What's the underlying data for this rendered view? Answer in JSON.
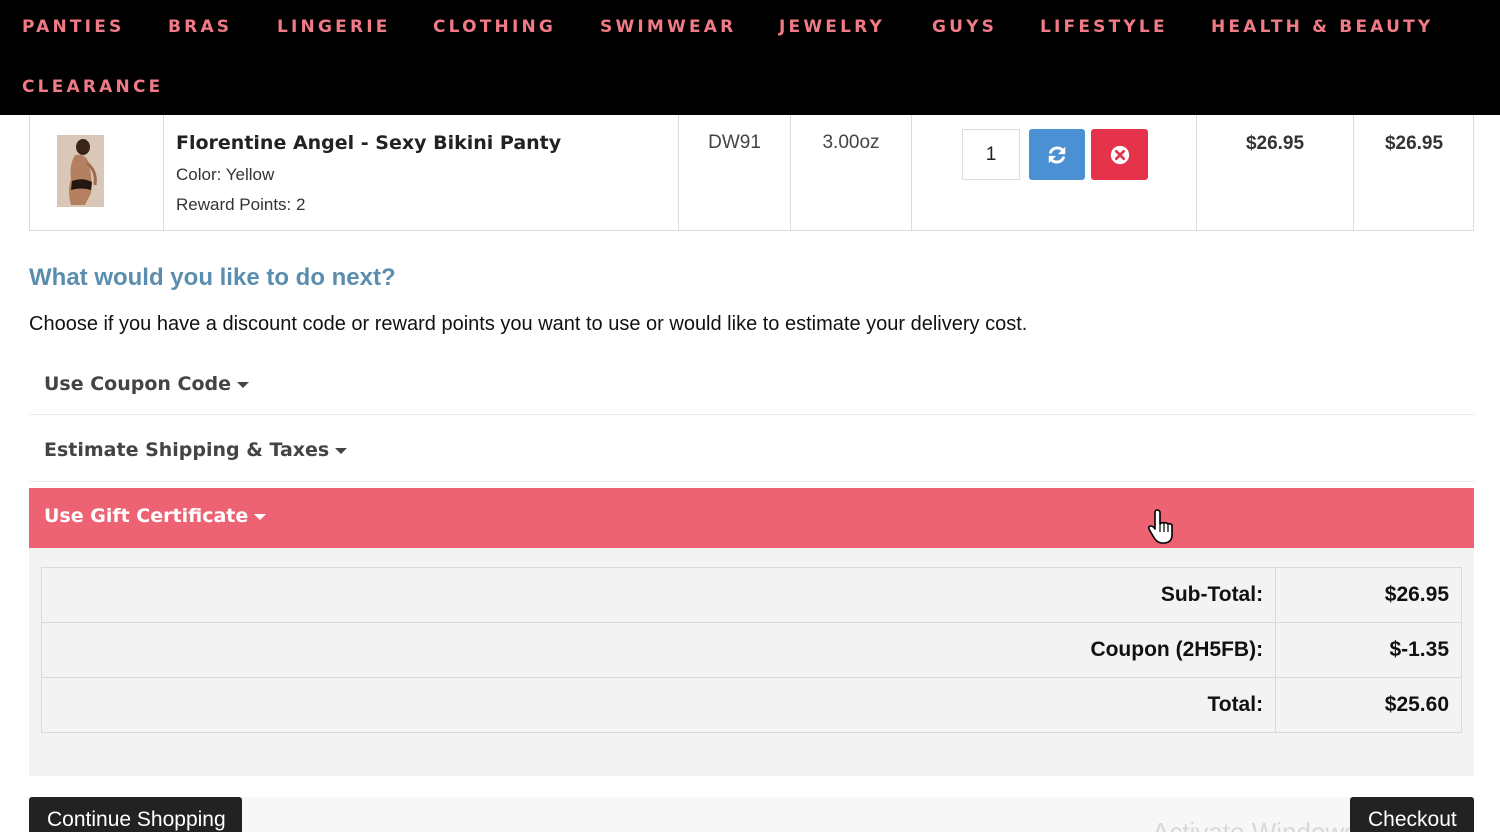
{
  "nav": {
    "items": [
      "PANTIES",
      "BRAS",
      "LINGERIE",
      "CLOTHING",
      "SWIMWEAR",
      "JEWELRY",
      "GUYS",
      "LIFESTYLE",
      "HEALTH & BEAUTY",
      "CLEARANCE"
    ],
    "text_color": "#f07a86",
    "background": "#000000"
  },
  "cart_item": {
    "name": "Florentine Angel - Sexy Bikini Panty",
    "color_option": "Color: Yellow",
    "reward_points": "Reward Points: 2",
    "model": "DW91",
    "weight": "3.00oz",
    "quantity": "1",
    "unit_price": "$26.95",
    "total": "$26.95",
    "update_icon": "refresh-icon",
    "remove_icon": "remove-circle-icon"
  },
  "next_steps": {
    "heading": "What would you like to do next?",
    "description": "Choose if you have a discount code or reward points you want to use or would like to estimate your delivery cost.",
    "sections": [
      {
        "label": "Use Coupon Code",
        "active": false
      },
      {
        "label": "Estimate Shipping & Taxes",
        "active": false
      },
      {
        "label": "Use Gift Certificate",
        "active": true
      }
    ],
    "active_color": "#ee6373",
    "heading_color": "#5b8eae"
  },
  "totals": [
    {
      "label": "Sub-Total:",
      "value": "$26.95"
    },
    {
      "label": "Coupon (2H5FB):",
      "value": "$-1.35"
    },
    {
      "label": "Total:",
      "value": "$25.60"
    }
  ],
  "buttons": {
    "continue_shopping": "Continue Shopping",
    "checkout": "Checkout"
  },
  "watermark": "Activate Windows",
  "colors": {
    "update_button": "#4a90d2",
    "remove_button": "#e5334b"
  }
}
